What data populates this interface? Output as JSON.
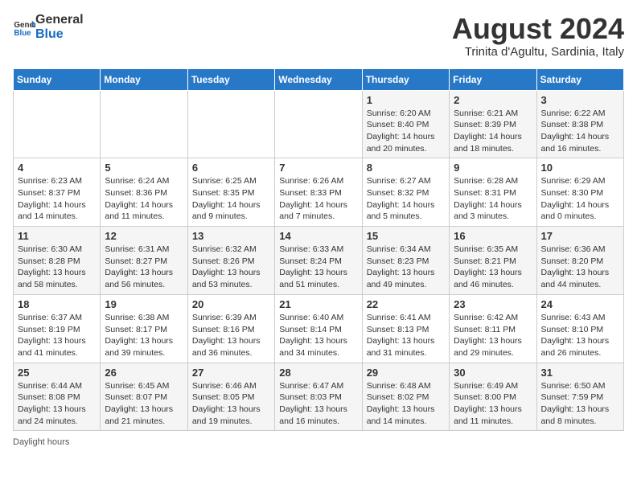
{
  "logo": {
    "line1": "General",
    "line2": "Blue"
  },
  "title": "August 2024",
  "subtitle": "Trinita d'Agultu, Sardinia, Italy",
  "days_of_week": [
    "Sunday",
    "Monday",
    "Tuesday",
    "Wednesday",
    "Thursday",
    "Friday",
    "Saturday"
  ],
  "weeks": [
    [
      {
        "day": "",
        "info": ""
      },
      {
        "day": "",
        "info": ""
      },
      {
        "day": "",
        "info": ""
      },
      {
        "day": "",
        "info": ""
      },
      {
        "day": "1",
        "info": "Sunrise: 6:20 AM\nSunset: 8:40 PM\nDaylight: 14 hours and 20 minutes."
      },
      {
        "day": "2",
        "info": "Sunrise: 6:21 AM\nSunset: 8:39 PM\nDaylight: 14 hours and 18 minutes."
      },
      {
        "day": "3",
        "info": "Sunrise: 6:22 AM\nSunset: 8:38 PM\nDaylight: 14 hours and 16 minutes."
      }
    ],
    [
      {
        "day": "4",
        "info": "Sunrise: 6:23 AM\nSunset: 8:37 PM\nDaylight: 14 hours and 14 minutes."
      },
      {
        "day": "5",
        "info": "Sunrise: 6:24 AM\nSunset: 8:36 PM\nDaylight: 14 hours and 11 minutes."
      },
      {
        "day": "6",
        "info": "Sunrise: 6:25 AM\nSunset: 8:35 PM\nDaylight: 14 hours and 9 minutes."
      },
      {
        "day": "7",
        "info": "Sunrise: 6:26 AM\nSunset: 8:33 PM\nDaylight: 14 hours and 7 minutes."
      },
      {
        "day": "8",
        "info": "Sunrise: 6:27 AM\nSunset: 8:32 PM\nDaylight: 14 hours and 5 minutes."
      },
      {
        "day": "9",
        "info": "Sunrise: 6:28 AM\nSunset: 8:31 PM\nDaylight: 14 hours and 3 minutes."
      },
      {
        "day": "10",
        "info": "Sunrise: 6:29 AM\nSunset: 8:30 PM\nDaylight: 14 hours and 0 minutes."
      }
    ],
    [
      {
        "day": "11",
        "info": "Sunrise: 6:30 AM\nSunset: 8:28 PM\nDaylight: 13 hours and 58 minutes."
      },
      {
        "day": "12",
        "info": "Sunrise: 6:31 AM\nSunset: 8:27 PM\nDaylight: 13 hours and 56 minutes."
      },
      {
        "day": "13",
        "info": "Sunrise: 6:32 AM\nSunset: 8:26 PM\nDaylight: 13 hours and 53 minutes."
      },
      {
        "day": "14",
        "info": "Sunrise: 6:33 AM\nSunset: 8:24 PM\nDaylight: 13 hours and 51 minutes."
      },
      {
        "day": "15",
        "info": "Sunrise: 6:34 AM\nSunset: 8:23 PM\nDaylight: 13 hours and 49 minutes."
      },
      {
        "day": "16",
        "info": "Sunrise: 6:35 AM\nSunset: 8:21 PM\nDaylight: 13 hours and 46 minutes."
      },
      {
        "day": "17",
        "info": "Sunrise: 6:36 AM\nSunset: 8:20 PM\nDaylight: 13 hours and 44 minutes."
      }
    ],
    [
      {
        "day": "18",
        "info": "Sunrise: 6:37 AM\nSunset: 8:19 PM\nDaylight: 13 hours and 41 minutes."
      },
      {
        "day": "19",
        "info": "Sunrise: 6:38 AM\nSunset: 8:17 PM\nDaylight: 13 hours and 39 minutes."
      },
      {
        "day": "20",
        "info": "Sunrise: 6:39 AM\nSunset: 8:16 PM\nDaylight: 13 hours and 36 minutes."
      },
      {
        "day": "21",
        "info": "Sunrise: 6:40 AM\nSunset: 8:14 PM\nDaylight: 13 hours and 34 minutes."
      },
      {
        "day": "22",
        "info": "Sunrise: 6:41 AM\nSunset: 8:13 PM\nDaylight: 13 hours and 31 minutes."
      },
      {
        "day": "23",
        "info": "Sunrise: 6:42 AM\nSunset: 8:11 PM\nDaylight: 13 hours and 29 minutes."
      },
      {
        "day": "24",
        "info": "Sunrise: 6:43 AM\nSunset: 8:10 PM\nDaylight: 13 hours and 26 minutes."
      }
    ],
    [
      {
        "day": "25",
        "info": "Sunrise: 6:44 AM\nSunset: 8:08 PM\nDaylight: 13 hours and 24 minutes."
      },
      {
        "day": "26",
        "info": "Sunrise: 6:45 AM\nSunset: 8:07 PM\nDaylight: 13 hours and 21 minutes."
      },
      {
        "day": "27",
        "info": "Sunrise: 6:46 AM\nSunset: 8:05 PM\nDaylight: 13 hours and 19 minutes."
      },
      {
        "day": "28",
        "info": "Sunrise: 6:47 AM\nSunset: 8:03 PM\nDaylight: 13 hours and 16 minutes."
      },
      {
        "day": "29",
        "info": "Sunrise: 6:48 AM\nSunset: 8:02 PM\nDaylight: 13 hours and 14 minutes."
      },
      {
        "day": "30",
        "info": "Sunrise: 6:49 AM\nSunset: 8:00 PM\nDaylight: 13 hours and 11 minutes."
      },
      {
        "day": "31",
        "info": "Sunrise: 6:50 AM\nSunset: 7:59 PM\nDaylight: 13 hours and 8 minutes."
      }
    ]
  ],
  "footer": {
    "label": "Daylight hours"
  }
}
